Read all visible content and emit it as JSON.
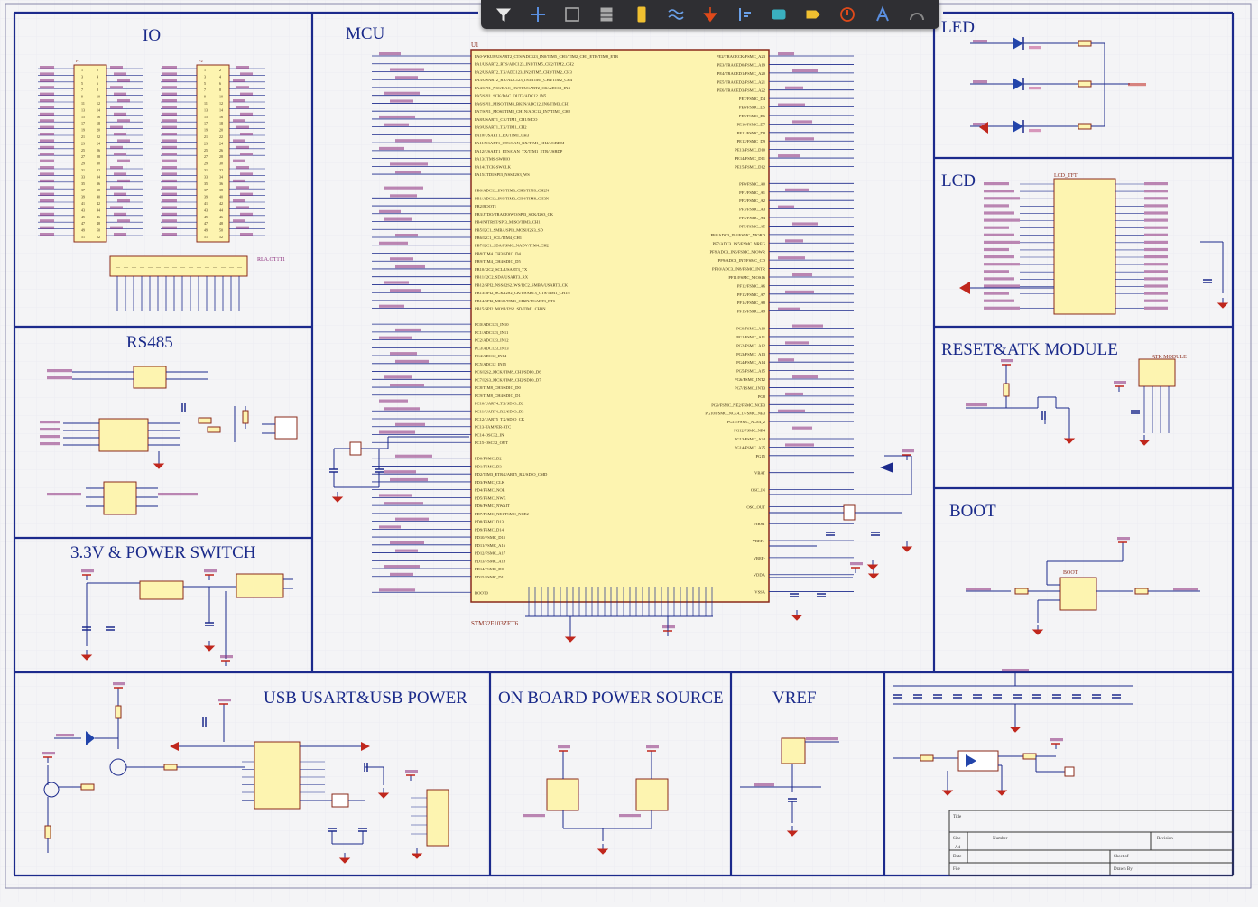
{
  "colors": {
    "background": "#f4f4f6",
    "border": "#1c2a8c",
    "wire": "#1c2a8c",
    "net_label": "#8a2a7a",
    "component_fill": "#fdf4b0",
    "component_stroke": "#8a2a1a",
    "power_red": "#c0271d",
    "toolbar_bg": "#2f2f33"
  },
  "toolbar": {
    "tools": [
      {
        "icon": "filter-icon",
        "color": "#e8e8e8"
      },
      {
        "icon": "crosshair-icon",
        "color": "#5a8fe0"
      },
      {
        "icon": "select-rect-icon",
        "color": "#aaaaaa"
      },
      {
        "icon": "align-icon",
        "color": "#aaaaaa"
      },
      {
        "icon": "component-icon",
        "color": "#f0c030"
      },
      {
        "icon": "wire-icon",
        "color": "#6aa0e8"
      },
      {
        "icon": "ground-icon",
        "color": "#e04a1a"
      },
      {
        "icon": "bus-icon",
        "color": "#6aa0e8"
      },
      {
        "icon": "sheet-icon",
        "color": "#3ab0c0"
      },
      {
        "icon": "port-icon",
        "color": "#f0c030"
      },
      {
        "icon": "no-erc-icon",
        "color": "#e04a1a"
      },
      {
        "icon": "text-icon",
        "color": "#5a8fe0"
      },
      {
        "icon": "arc-icon",
        "color": "#888888"
      }
    ]
  },
  "sections": {
    "io": "IO",
    "mcu": "MCU",
    "led": "LED",
    "lcd": "LCD",
    "rs485": "RS485",
    "reset_atk": "RESET&ATK MODULE",
    "power_switch": "3.3V & POWER SWITCH",
    "boot": "BOOT",
    "usb": "USB USART&USB POWER",
    "onboard_power": "ON BOARD POWER SOURCE",
    "vref": "VREF"
  },
  "mcu": {
    "left_pins": [
      "PA0-WKUP/USART2_CTS/ADC123_IN0/TIM5_CH1/TIM2_CH1_ETR/TIM8_ETR",
      "PA1/USART2_RTS/ADC123_IN1/TIM5_CH2/TIM2_CH2",
      "PA2/USART2_TX/ADC123_IN2/TIM5_CH3/TIM2_CH3",
      "PA3/USART2_RX/ADC123_IN3/TIM5_CH4/TIM2_CH4",
      "PA4/SPI1_NSS/DAC_OUT1/USART2_CK/ADC12_IN4",
      "PA5/SPI1_SCK/DAC_OUT2/ADC12_IN5",
      "PA6/SPI1_MISO/TIM8_BKIN/ADC12_IN6/TIM3_CH1",
      "PA7/SPI1_MOSI/TIM8_CH1N/ADC12_IN7/TIM3_CH2",
      "PA8/USART1_CK/TIM1_CH1/MCO",
      "PA9/USART1_TX/TIM1_CH2",
      "PA10/USART1_RX/TIM1_CH3",
      "PA11/USART1_CTS/CAN_RX/TIM1_CH4/USBDM",
      "PA12/USART1_RTS/CAN_TX/TIM1_ETR/USBDP",
      "PA13/JTMS-SWDIO",
      "PA14/JTCK-SWCLK",
      "PA15/JTDI/SPI3_NSS/I2S3_WS",
      "",
      "PB0/ADC12_IN8/TIM3_CH3/TIM8_CH2N",
      "PB1/ADC12_IN9/TIM3_CH4/TIM8_CH3N",
      "PB2/BOOT1",
      "PB3/JTDO/TRACESWO/SPI3_SCK/I2S3_CK",
      "PB4/NJTRST/SPI3_MISO/TIM3_CH1",
      "PB5/I2C1_SMBA/SPI3_MOSI/I2S3_SD",
      "PB6/I2C1_SCL/TIM4_CH1",
      "PB7/I2C1_SDA/FSMC_NADV/TIM4_CH2",
      "PB8/TIM4_CH3/SDIO_D4",
      "PB9/TIM4_CH4/SDIO_D5",
      "PB10/I2C2_SCL/USART3_TX",
      "PB11/I2C2_SDA/USART3_RX",
      "PB12/SPI2_NSS/I2S2_WS/I2C2_SMBA/USART3_CK",
      "PB13/SPI2_SCK/I2S2_CK/USART3_CTS/TIM1_CH1N",
      "PB14/SPI2_MISO/TIM1_CH2N/USART3_RTS",
      "PB15/SPI2_MOSI/I2S2_SD/TIM1_CH3N",
      "",
      "PC0/ADC123_IN10",
      "PC1/ADC123_IN11",
      "PC2/ADC123_IN12",
      "PC3/ADC123_IN13",
      "PC4/ADC12_IN14",
      "PC5/ADC12_IN15",
      "PC6/I2S2_MCK/TIM8_CH1/SDIO_D6",
      "PC7/I2S3_MCK/TIM8_CH2/SDIO_D7",
      "PC8/TIM8_CH3/SDIO_D0",
      "PC9/TIM8_CH4/SDIO_D1",
      "PC10/UART4_TX/SDIO_D2",
      "PC11/UART4_RX/SDIO_D3",
      "PC12/UART5_TX/SDIO_CK",
      "PC13-TAMPER-RTC",
      "PC14-OSC32_IN",
      "PC15-OSC32_OUT",
      "",
      "PD0/FSMC_D2",
      "PD1/FSMC_D3",
      "PD2/TIM3_ETR/UART5_RX/SDIO_CMD",
      "PD3/FSMC_CLK",
      "PD4/FSMC_NOE",
      "PD5/FSMC_NWE",
      "PD6/FSMC_NWAIT",
      "PD7/FSMC_NE1/FSMC_NCE2",
      "PD8/FSMC_D13",
      "PD9/FSMC_D14",
      "PD10/FSMC_D15",
      "PD11/FSMC_A16",
      "PD12/FSMC_A17",
      "PD13/FSMC_A18",
      "PD14/FSMC_D0",
      "PD15/FSMC_D1",
      "",
      "BOOT0"
    ],
    "right_pins": [
      "PE2/TRACECK/FSMC_A23",
      "PE3/TRACED0/FSMC_A19",
      "PE4/TRACED1/FSMC_A20",
      "PE5/TRACED2/FSMC_A21",
      "PE6/TRACED3/FSMC_A22",
      "PE7/FSMC_D4",
      "PE8/FSMC_D5",
      "PE9/FSMC_D6",
      "PE10/FSMC_D7",
      "PE11/FSMC_D8",
      "PE12/FSMC_D9",
      "PE13/FSMC_D10",
      "PE14/FSMC_D11",
      "PE15/FSMC_D12",
      "",
      "PF0/FSMC_A0",
      "PF1/FSMC_A1",
      "PF2/FSMC_A2",
      "PF3/FSMC_A3",
      "PF4/FSMC_A4",
      "PF5/FSMC_A5",
      "PF6/ADC3_IN4/FSMC_NIORD",
      "PF7/ADC3_IN5/FSMC_NREG",
      "PF8/ADC3_IN6/FSMC_NIOWR",
      "PF9/ADC3_IN7/FSMC_CD",
      "PF10/ADC3_IN8/FSMC_INTR",
      "PF11/FSMC_NIOS16",
      "PF12/FSMC_A6",
      "PF13/FSMC_A7",
      "PF14/FSMC_A8",
      "PF15/FSMC_A9",
      "",
      "PG0/FSMC_A10",
      "PG1/FSMC_A11",
      "PG2/FSMC_A12",
      "PG3/FSMC_A13",
      "PG4/FSMC_A14",
      "PG5/FSMC_A15",
      "PG6/FSMC_INT2",
      "PG7/FSMC_INT3",
      "PG8",
      "PG9/FSMC_NE2/FSMC_NCE3",
      "PG10/FSMC_NCE4_1/FSMC_NE3",
      "PG11/FSMC_NCE4_2",
      "PG12/FSMC_NE4",
      "PG13/FSMC_A24",
      "PG14/FSMC_A25",
      "PG15",
      "",
      "VBAT",
      "",
      "OSC_IN",
      "",
      "OSC_OUT",
      "",
      "NRST",
      "",
      "VREF+",
      "",
      "VREF-",
      "",
      "VDDA",
      "",
      "VSSA"
    ],
    "part_name": "STM32F103ZET6",
    "ref": "U1"
  },
  "power_nets": {
    "vcc": "VCC3.3",
    "gnd": "GND"
  },
  "labels": {
    "io_header": "RLA.OT1T1",
    "lcd_part": "LCD_TFT",
    "atk_module": "ATK MODULE",
    "boot_part": "BOOT",
    "title_block": [
      "Title",
      "Size",
      "Number",
      "Revision",
      "A4",
      "Date",
      "File",
      "Sheet of",
      "Drawn By"
    ]
  }
}
